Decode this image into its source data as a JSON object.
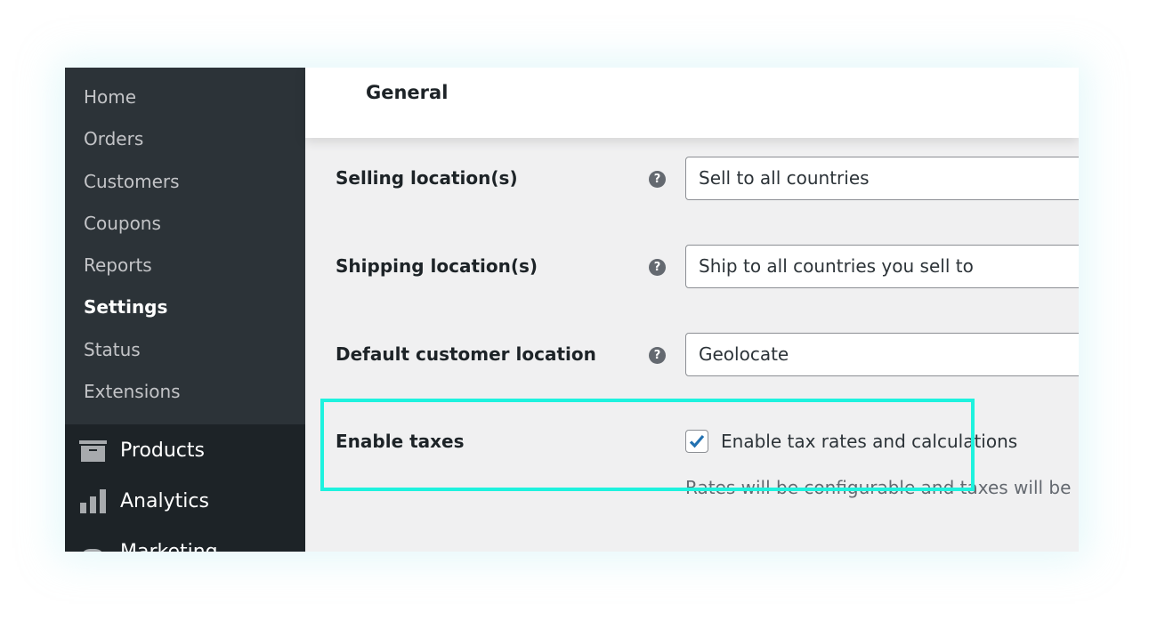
{
  "sidebar": {
    "submenu": [
      "Home",
      "Orders",
      "Customers",
      "Coupons",
      "Reports",
      "Settings",
      "Status",
      "Extensions"
    ],
    "active": "Settings",
    "menu": [
      {
        "label": "Products",
        "icon": "archive-box-icon"
      },
      {
        "label": "Analytics",
        "icon": "bar-chart-icon"
      },
      {
        "label": "Marketing",
        "icon": "megaphone-icon"
      }
    ]
  },
  "header": {
    "title": "General"
  },
  "fields": [
    {
      "label": "Selling location(s)",
      "value": "Sell to all countries"
    },
    {
      "label": "Shipping location(s)",
      "value": "Ship to all countries you sell to"
    },
    {
      "label": "Default customer location",
      "value": "Geolocate"
    }
  ],
  "taxes": {
    "label": "Enable taxes",
    "checkbox_label": "Enable tax rates and calculations",
    "checked": true,
    "description": "Rates will be configurable and taxes will be"
  },
  "colors": {
    "highlight": "#1ef2de",
    "sidebar": "#2c3338",
    "checkmark": "#2271b1"
  }
}
